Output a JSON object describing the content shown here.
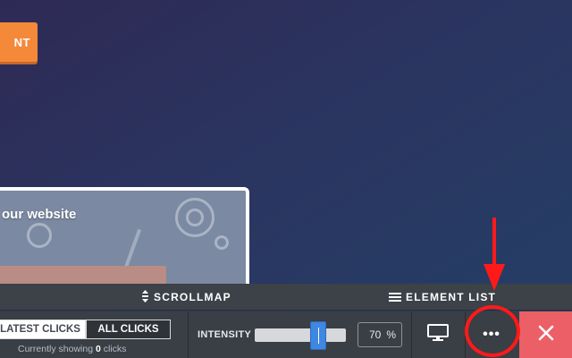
{
  "website": {
    "cta_label": "NT",
    "card_title": "our website"
  },
  "toolbar": {
    "scrollmap_label": "SCROLLMAP",
    "element_list_label": "ELEMENT LIST",
    "latest_clicks_label": "LATEST CLICKS",
    "all_clicks_label": "ALL CLICKS",
    "showing_prefix": "Currently showing",
    "showing_count": "0",
    "showing_suffix": "clicks",
    "intensity_label": "INTENSITY",
    "intensity_value": "70",
    "intensity_unit": "%",
    "intensity_fraction": 0.7,
    "more_label": "•••",
    "icons": {
      "scrollmap": "vertical-arrows-icon",
      "element_list": "list-icon",
      "device": "desktop-monitor-icon",
      "close": "close-x-icon"
    }
  },
  "colors": {
    "accent_orange": "#f5893a",
    "toolbar_bg": "#3a3e45",
    "slider_handle": "#3f87e0",
    "close_bg": "#ec5f66",
    "annotation_red": "#ff1a1a"
  }
}
